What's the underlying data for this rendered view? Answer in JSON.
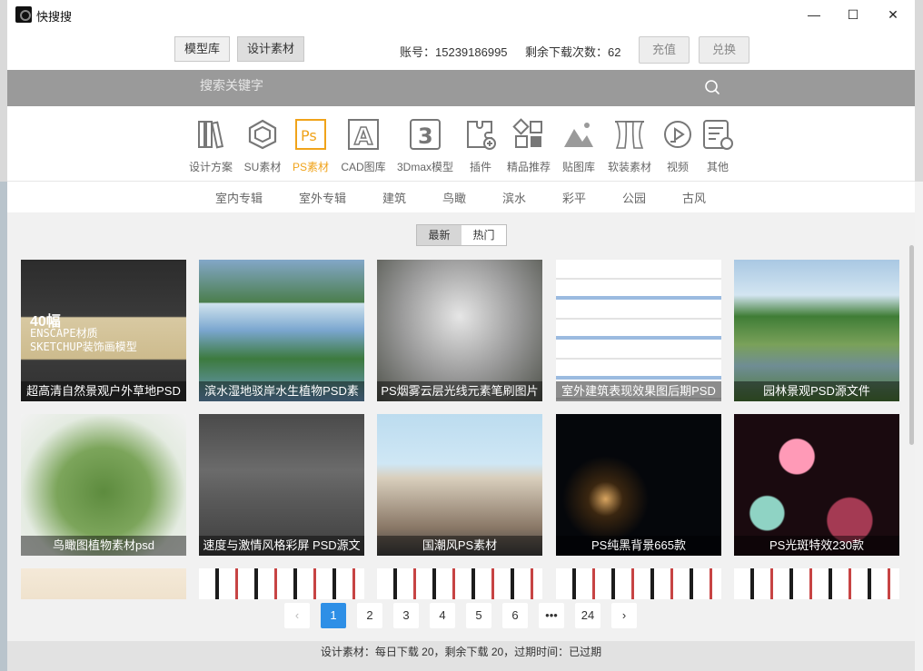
{
  "app": {
    "title": "快搜搜"
  },
  "window_controls": {
    "minimize": "—",
    "maximize": "☐",
    "close": "✕"
  },
  "topbar": {
    "tabs": [
      {
        "label": "模型库"
      },
      {
        "label": "设计素材"
      }
    ],
    "account": "账号：15239186995",
    "remaining": "剩余下载次数：62",
    "recharge_label": "充值",
    "exchange_label": "兑换"
  },
  "search": {
    "placeholder": "搜索关键字",
    "icon": "search-icon"
  },
  "categories": [
    {
      "label": "设计方案",
      "icon": "books-icon"
    },
    {
      "label": "SU素材",
      "icon": "sketchup-icon"
    },
    {
      "label": "PS素材",
      "icon": "photoshop-icon",
      "active": true
    },
    {
      "label": "CAD图库",
      "icon": "cad-icon"
    },
    {
      "label": "3Dmax模型",
      "icon": "3dmax-icon"
    },
    {
      "label": "插件",
      "icon": "plugin-icon"
    },
    {
      "label": "精品推荐",
      "icon": "recommend-icon"
    },
    {
      "label": "贴图库",
      "icon": "texture-icon"
    },
    {
      "label": "软装素材",
      "icon": "curtain-icon"
    },
    {
      "label": "视频",
      "icon": "video-icon"
    },
    {
      "label": "其他",
      "icon": "other-icon"
    }
  ],
  "subcategories": [
    "室内专辑",
    "室外专辑",
    "建筑",
    "鸟瞰",
    "滨水",
    "彩平",
    "公园",
    "古风"
  ],
  "sort": {
    "newest": "最新",
    "hot": "热门"
  },
  "items": [
    {
      "caption": "超高清自然景观户外草地PSD"
    },
    {
      "caption": "滨水湿地驳岸水生植物PSD素"
    },
    {
      "caption": "PS烟雾云层光线元素笔刷图片"
    },
    {
      "caption": "室外建筑表现效果图后期PSD"
    },
    {
      "caption": "园林景观PSD源文件"
    },
    {
      "caption": "鸟瞰图植物素材psd"
    },
    {
      "caption": "速度与激情风格彩屏 PSD源文"
    },
    {
      "caption": "国潮风PS素材"
    },
    {
      "caption": "PS纯黑背景665款"
    },
    {
      "caption": "PS光斑特效230款"
    }
  ],
  "thumb_text": {
    "t1_big": "40幅",
    "t1_line1": "ENSCAPE材质",
    "t1_line2": "SKETCHUP装饰画模型"
  },
  "pagination": {
    "prev": "‹",
    "pages": [
      "1",
      "2",
      "3",
      "4",
      "5",
      "6",
      "•••",
      "24"
    ],
    "next": "›",
    "current": "1"
  },
  "status": {
    "text": "设计素材：每日下载 20，剩余下载 20，过期时间：已过期"
  },
  "colors": {
    "accent": "#f0a31a",
    "page_active": "#2e8fe6",
    "search_bg": "#9a9a9a"
  }
}
